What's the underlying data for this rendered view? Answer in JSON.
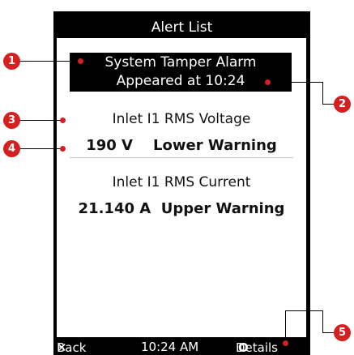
{
  "header": {
    "top_fragment": "",
    "title": "Alert List"
  },
  "alert": {
    "line1": "System Tamper Alarm",
    "line2": "Appeared at 10:24"
  },
  "sensors": [
    {
      "label": "Inlet I1 RMS Voltage",
      "value": "190 V",
      "status": "Lower Warning"
    },
    {
      "label": "Inlet I1 RMS Current",
      "value": "21.140 A",
      "status": "Upper Warning"
    }
  ],
  "footer": {
    "back": "Back",
    "time": "10:24 AM",
    "details": "Details"
  },
  "callouts": [
    "1",
    "2",
    "3",
    "4",
    "5"
  ],
  "colors": {
    "badge": "#d42020",
    "device": "#000000",
    "screen": "#ffffff"
  }
}
